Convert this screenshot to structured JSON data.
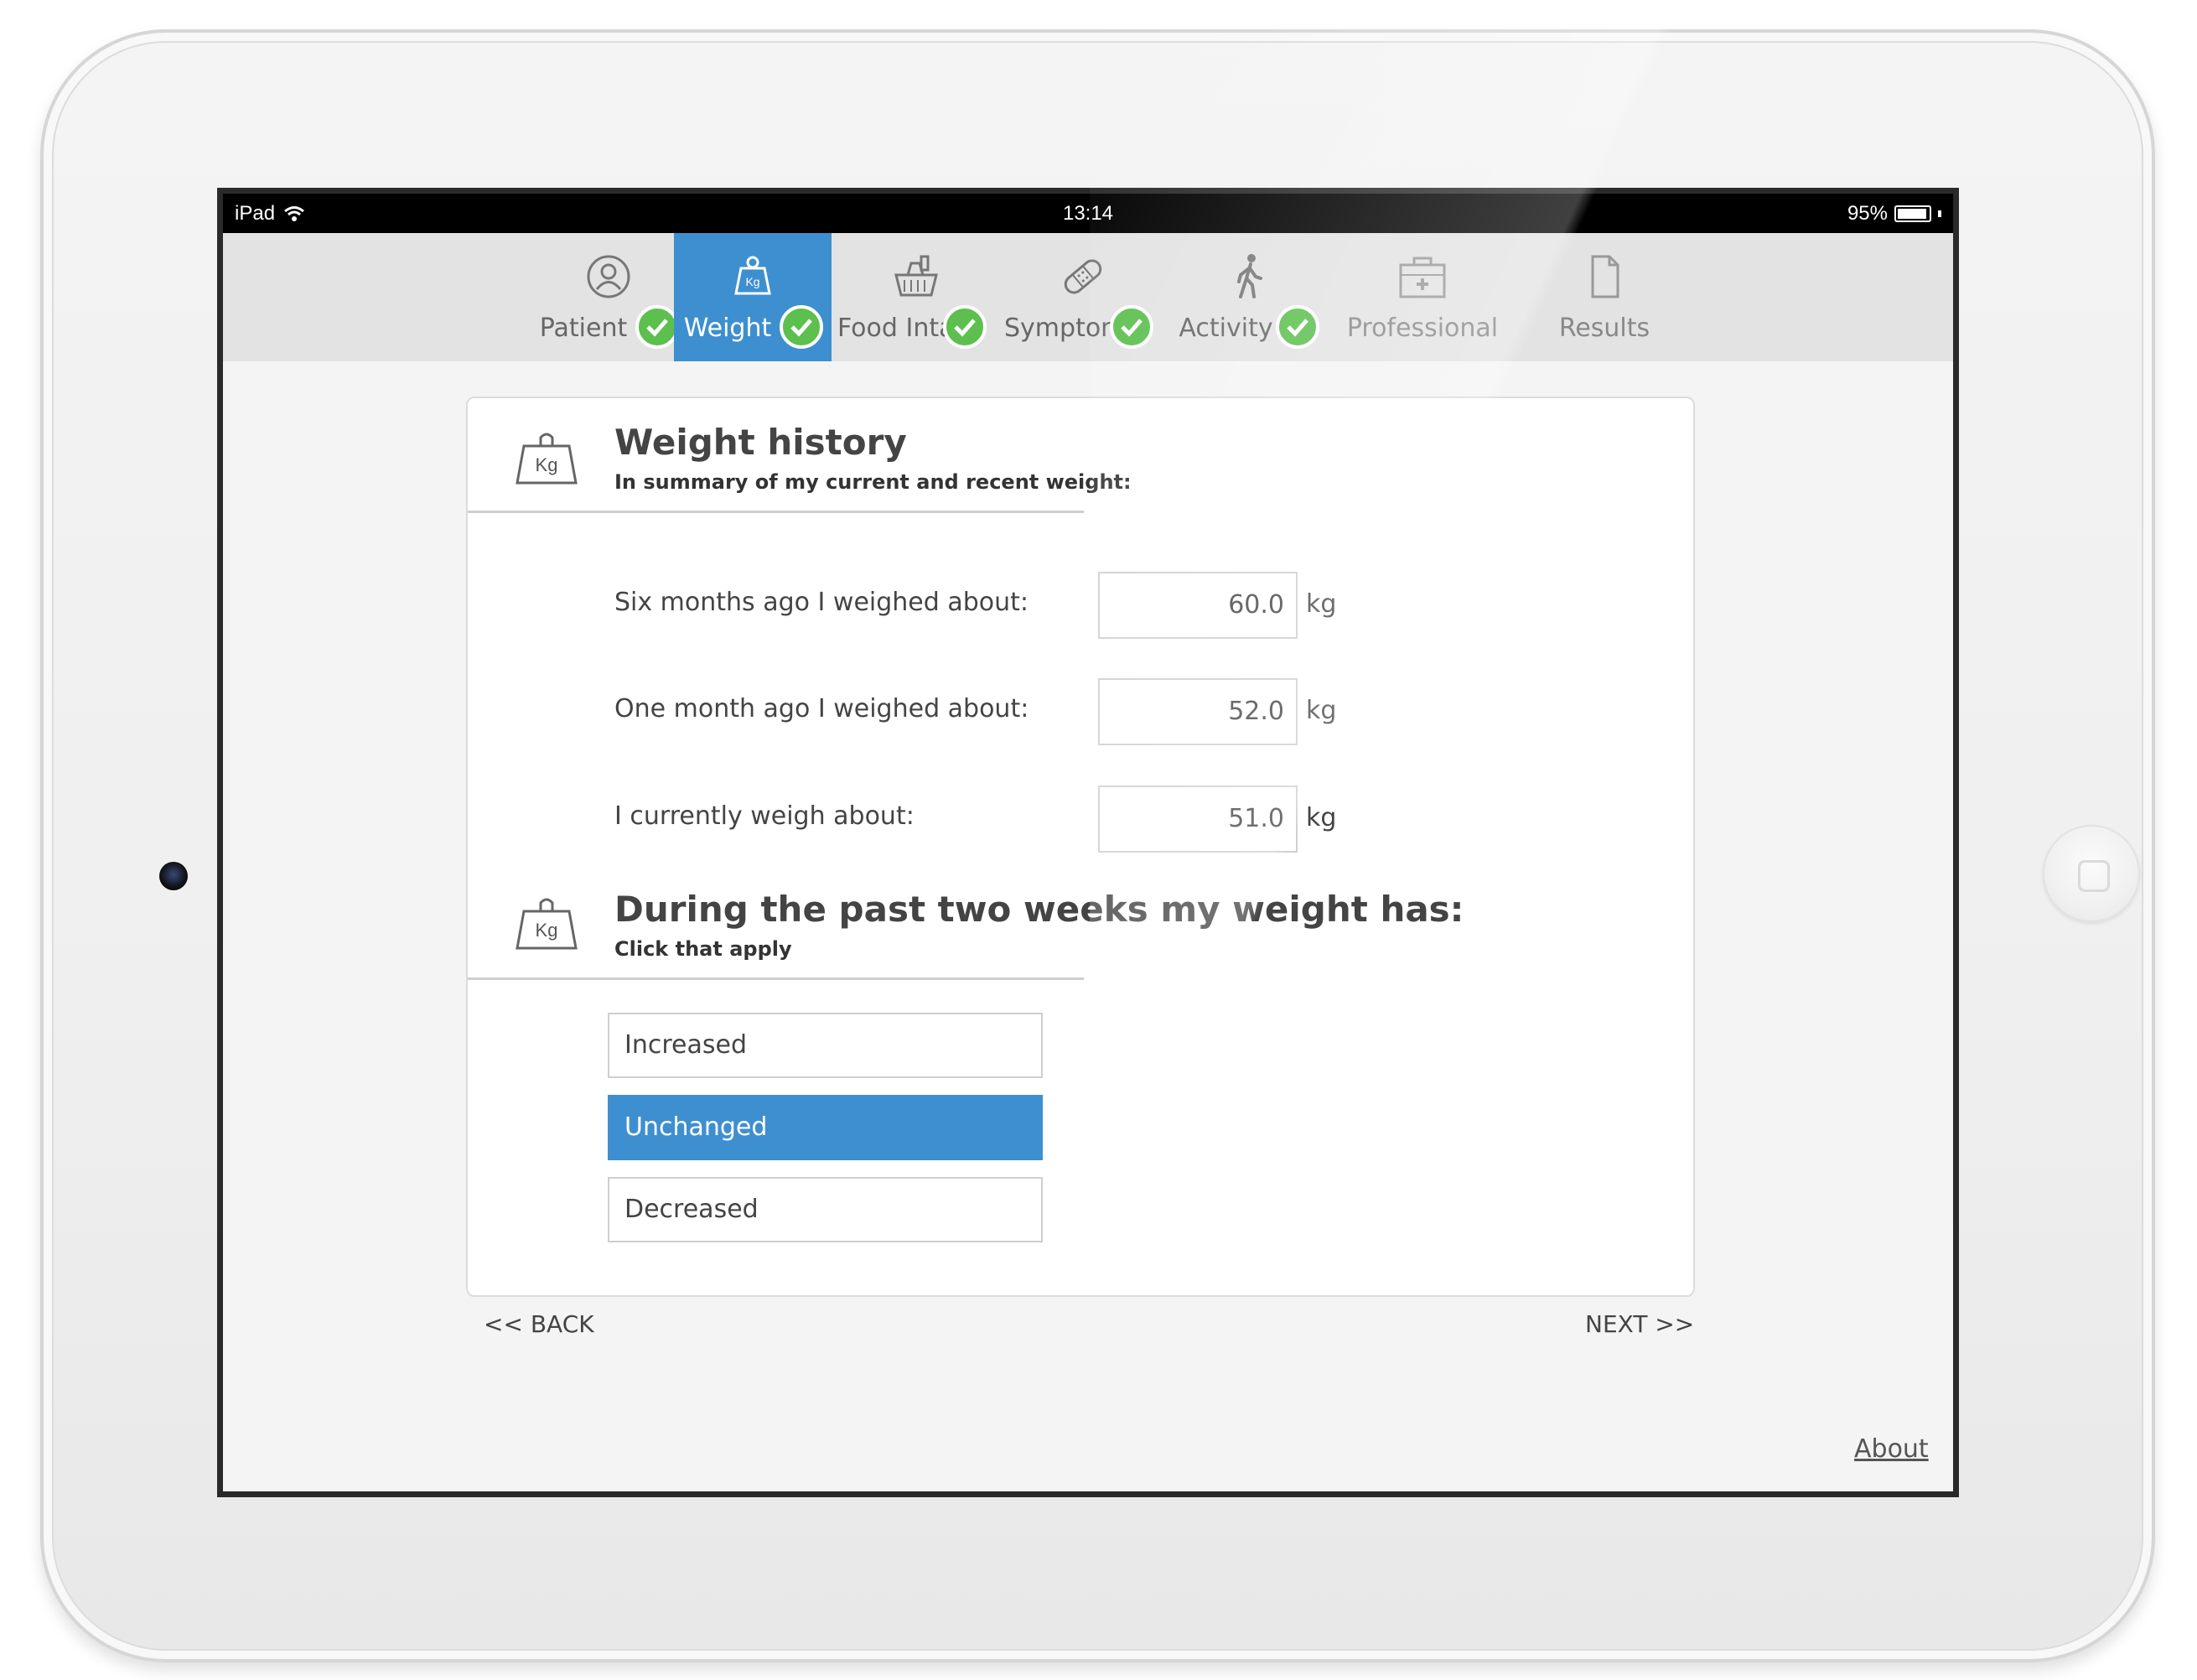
{
  "status_bar": {
    "device": "iPad",
    "time": "13:14",
    "battery": "95%",
    "battery_level": 0.95
  },
  "tabs": [
    {
      "label": "Patient",
      "icon": "user-icon",
      "completed": true,
      "active": false
    },
    {
      "label": "Weight",
      "icon": "weight-icon",
      "completed": true,
      "active": true
    },
    {
      "label": "Food Intake",
      "icon": "food-basket-icon",
      "completed": true,
      "active": false
    },
    {
      "label": "Symptoms",
      "icon": "bandage-icon",
      "completed": true,
      "active": false
    },
    {
      "label": "Activity",
      "icon": "walking-icon",
      "completed": true,
      "active": false
    },
    {
      "label": "Professional",
      "icon": "medical-kit-icon",
      "completed": false,
      "active": false
    },
    {
      "label": "Results",
      "icon": "document-icon",
      "completed": false,
      "active": false
    }
  ],
  "weight_history": {
    "icon_text": "Kg",
    "title": "Weight history",
    "subtitle": "In summary of my current and recent weight:",
    "rows": [
      {
        "label": "Six months ago I weighed about:",
        "value": "60.0",
        "unit": "kg"
      },
      {
        "label": "One month ago I weighed about:",
        "value": "52.0",
        "unit": "kg"
      },
      {
        "label": "I currently weigh about:",
        "value": "51.0",
        "unit": "kg"
      }
    ]
  },
  "two_weeks": {
    "icon_text": "Kg",
    "title": "During the past two weeks my weight has:",
    "subtitle": "Click that apply",
    "options": [
      {
        "label": "Increased",
        "selected": false
      },
      {
        "label": "Unchanged",
        "selected": true
      },
      {
        "label": "Decreased",
        "selected": false
      }
    ]
  },
  "nav": {
    "back": "<< BACK",
    "next": "NEXT >>"
  },
  "footer": {
    "about": "About"
  },
  "colors": {
    "accent": "#3e8fd0",
    "check": "#5cbf4e",
    "tabbar": "#e3e3e3"
  }
}
